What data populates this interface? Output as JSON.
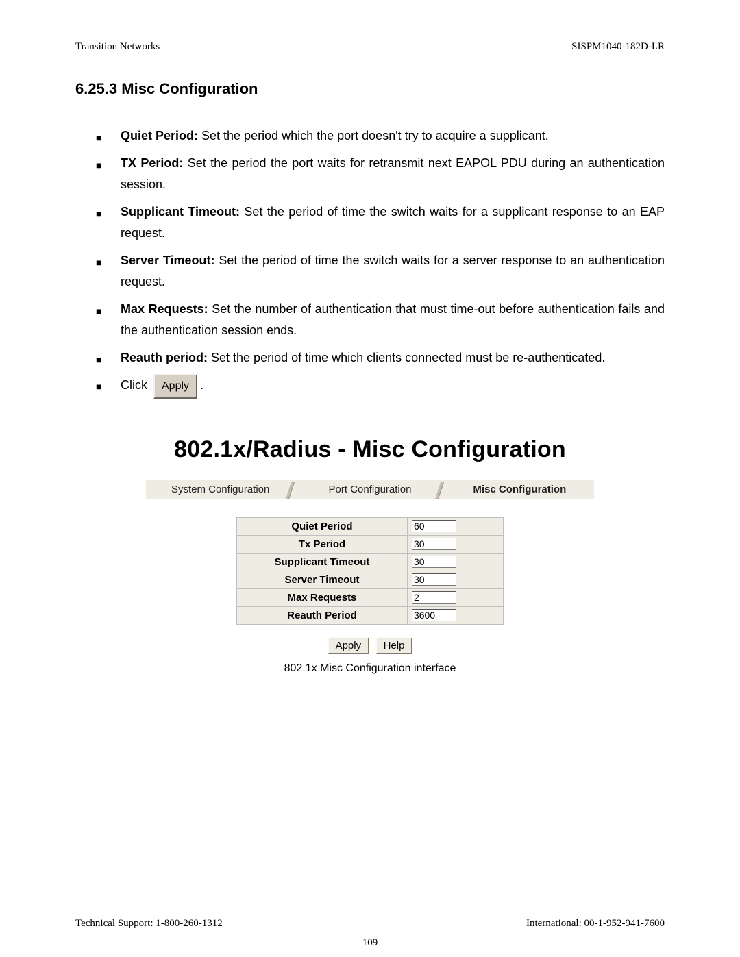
{
  "header": {
    "left": "Transition Networks",
    "right": "SISPM1040-182D-LR"
  },
  "section_heading": "6.25.3 Misc Configuration",
  "bullets": [
    {
      "bold": "Quiet Period:",
      "text": " Set the period which the port doesn't try to acquire a supplicant."
    },
    {
      "bold": "TX Period:",
      "text": " Set the period the port waits for retransmit next EAPOL PDU during an authentication session."
    },
    {
      "bold": "Supplicant Timeout:",
      "text": " Set the period of time the switch waits for a supplicant response to an EAP request."
    },
    {
      "bold": "Server Timeout:",
      "text": " Set the period of time the switch waits for a server response to an authentication request."
    },
    {
      "bold": "Max Requests:",
      "text": " Set the number of authentication that must time-out before authentication fails and the authentication session ends."
    },
    {
      "bold": "Reauth period:",
      "text": " Set the period of time which clients connected must be re-authenticated."
    }
  ],
  "click_line": {
    "prefix": "Click ",
    "button_label": "Apply",
    "suffix": "."
  },
  "figure": {
    "title": "802.1x/Radius - Misc Configuration",
    "tabs": [
      {
        "label": "System Configuration",
        "active": false
      },
      {
        "label": "Port Configuration",
        "active": false
      },
      {
        "label": "Misc Configuration",
        "active": true
      }
    ],
    "rows": [
      {
        "label": "Quiet Period",
        "value": "60"
      },
      {
        "label": "Tx Period",
        "value": "30"
      },
      {
        "label": "Supplicant Timeout",
        "value": "30"
      },
      {
        "label": "Server Timeout",
        "value": "30"
      },
      {
        "label": "Max Requests",
        "value": "2"
      },
      {
        "label": "Reauth Period",
        "value": "3600"
      }
    ],
    "buttons": {
      "apply": "Apply",
      "help": "Help"
    },
    "caption": "802.1x Misc Configuration interface"
  },
  "footer": {
    "left": "Technical Support: 1-800-260-1312",
    "right": "International: 00-1-952-941-7600",
    "page": "109"
  }
}
